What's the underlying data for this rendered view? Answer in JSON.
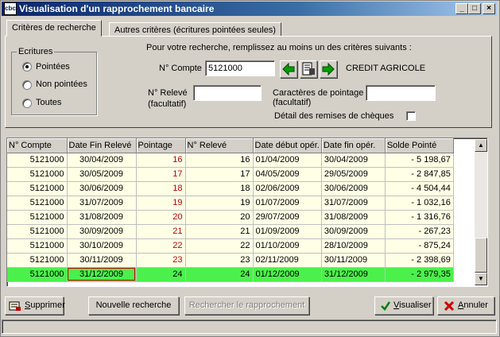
{
  "window": {
    "icon_text": "cbc",
    "title": "Visualisation d'un rapprochement bancaire",
    "minimize": "_",
    "maximize": "□",
    "close": "×"
  },
  "tabs": [
    {
      "label": "Critères de recherche",
      "active": true
    },
    {
      "label": "Autres critères (écritures pointées seules)",
      "active": false
    }
  ],
  "ecritures": {
    "legend": "Ecritures",
    "options": [
      "Pointées",
      "Non pointées",
      "Toutes"
    ],
    "selected": "Pointées"
  },
  "criteria": {
    "instruction": "Pour votre recherche, remplissez au moins un des critères suivants :",
    "compte_label": "N° Compte",
    "compte_value": "5121000",
    "bank_name": "CREDIT AGRICOLE",
    "releve_label": "N° Relevé",
    "releve_sub": "(facultatif)",
    "releve_value": "",
    "pointage_label": "Caractères de pointage",
    "pointage_sub": "(facultatif)",
    "pointage_value": "",
    "detail_label": "Détail des remises de chèques",
    "detail_checked": false
  },
  "grid": {
    "columns": [
      "N° Compte",
      "Date Fin Relevé",
      "Pointage",
      "N° Relevé",
      "Date début opér.",
      "Date fin opér.",
      "Solde Pointé"
    ],
    "rows": [
      [
        "5121000",
        "30/04/2009",
        "16",
        "16",
        "01/04/2009",
        "30/04/2009",
        "- 5 198,67"
      ],
      [
        "5121000",
        "30/05/2009",
        "17",
        "17",
        "04/05/2009",
        "29/05/2009",
        "- 2 847,85"
      ],
      [
        "5121000",
        "30/06/2009",
        "18",
        "18",
        "02/06/2009",
        "30/06/2009",
        "- 4 504,44"
      ],
      [
        "5121000",
        "31/07/2009",
        "19",
        "19",
        "01/07/2009",
        "31/07/2009",
        "- 1 032,16"
      ],
      [
        "5121000",
        "31/08/2009",
        "20",
        "20",
        "29/07/2009",
        "31/08/2009",
        "- 1 316,76"
      ],
      [
        "5121000",
        "30/09/2009",
        "21",
        "21",
        "01/09/2009",
        "30/09/2009",
        "- 267,23"
      ],
      [
        "5121000",
        "30/10/2009",
        "22",
        "22",
        "01/10/2009",
        "28/10/2009",
        "- 875,24"
      ],
      [
        "5121000",
        "30/11/2009",
        "23",
        "23",
        "02/11/2009",
        "30/11/2009",
        "- 2 398,69"
      ],
      [
        "5121000",
        "31/12/2009",
        "24",
        "24",
        "01/12/2009",
        "31/12/2009",
        "- 2 979,35"
      ]
    ],
    "selected_row": 8,
    "colors": {
      "row_bg": "#ffffe6",
      "selected_bg": "#4cf04c",
      "pointage_text": "#c00000"
    }
  },
  "buttons": {
    "supprimer_u": "S",
    "supprimer_rest": "upprimer",
    "nouvelle": "Nouvelle recherche",
    "rechercher": "Rechercher le rapprochement",
    "visualiser_u": "V",
    "visualiser_rest": "isualiser",
    "annuler_u": "A",
    "annuler_rest": "nnuler"
  }
}
